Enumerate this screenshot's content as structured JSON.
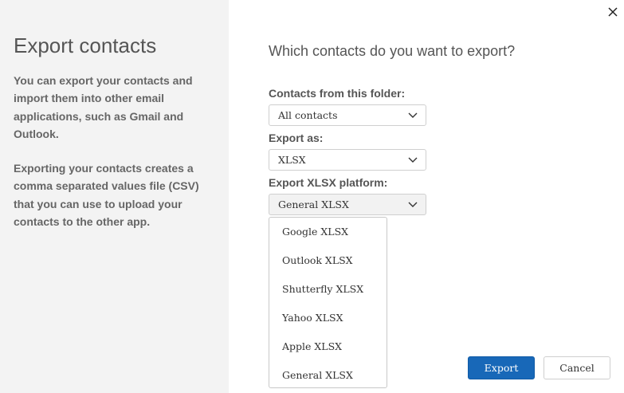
{
  "left": {
    "title": "Export contacts",
    "description1": "You can export your contacts and import them into other email applications, such as Gmail and Outlook.",
    "description2": "Exporting your contacts creates a comma separated values file (CSV) that you can use to upload your contacts to the other app."
  },
  "main": {
    "question": "Which contacts do you want to export?",
    "folder": {
      "label": "Contacts from this folder:",
      "value": "All contacts"
    },
    "format": {
      "label": "Export as:",
      "value": "XLSX"
    },
    "platform": {
      "label": "Export XLSX platform:",
      "value": "General XLSX",
      "options": [
        "Google XLSX",
        "Outlook XLSX",
        "Shutterfly XLSX",
        "Yahoo XLSX",
        "Apple XLSX",
        "General XLSX"
      ]
    }
  },
  "buttons": {
    "export": "Export",
    "cancel": "Cancel"
  },
  "icons": {
    "close": "close-icon",
    "dropdown": "chevron-down-icon"
  },
  "colors": {
    "accent": "#1868b8",
    "left_panel": "#f3f3f3"
  }
}
